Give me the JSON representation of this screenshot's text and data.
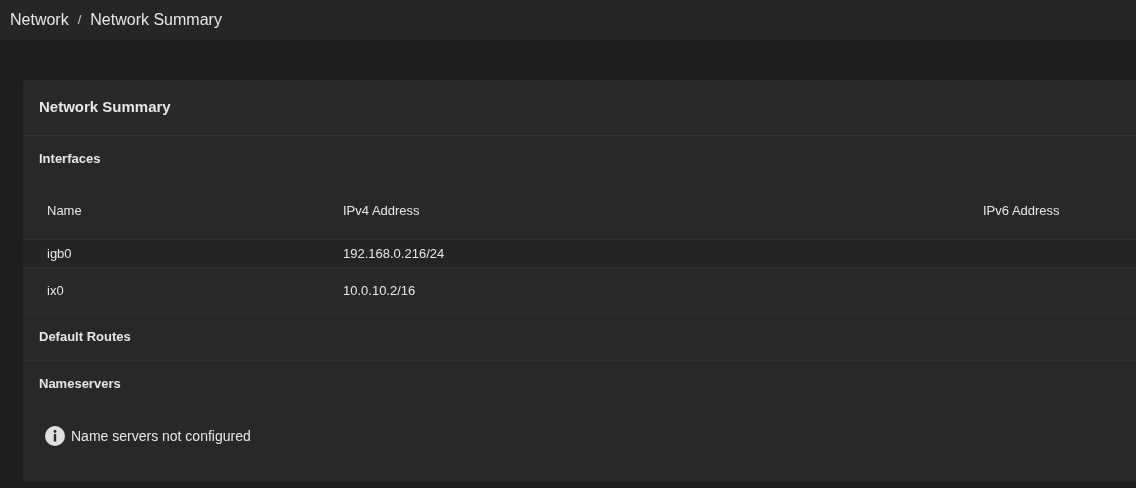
{
  "breadcrumb": [
    "Network",
    "Network Summary"
  ],
  "breadcrumb_separator": "/",
  "card": {
    "title": "Network Summary",
    "interfaces": {
      "heading": "Interfaces",
      "columns": [
        "Name",
        "IPv4 Address",
        "IPv6 Address"
      ],
      "rows": [
        {
          "cells": [
            "igb0",
            "192.168.0.216/24"
          ]
        },
        {
          "cells": [
            "ix0",
            "10.0.10.2/16"
          ]
        }
      ]
    },
    "default_routes": {
      "heading": "Default Routes"
    },
    "nameservers": {
      "heading": "Nameservers",
      "message": "Name servers not configured"
    }
  }
}
